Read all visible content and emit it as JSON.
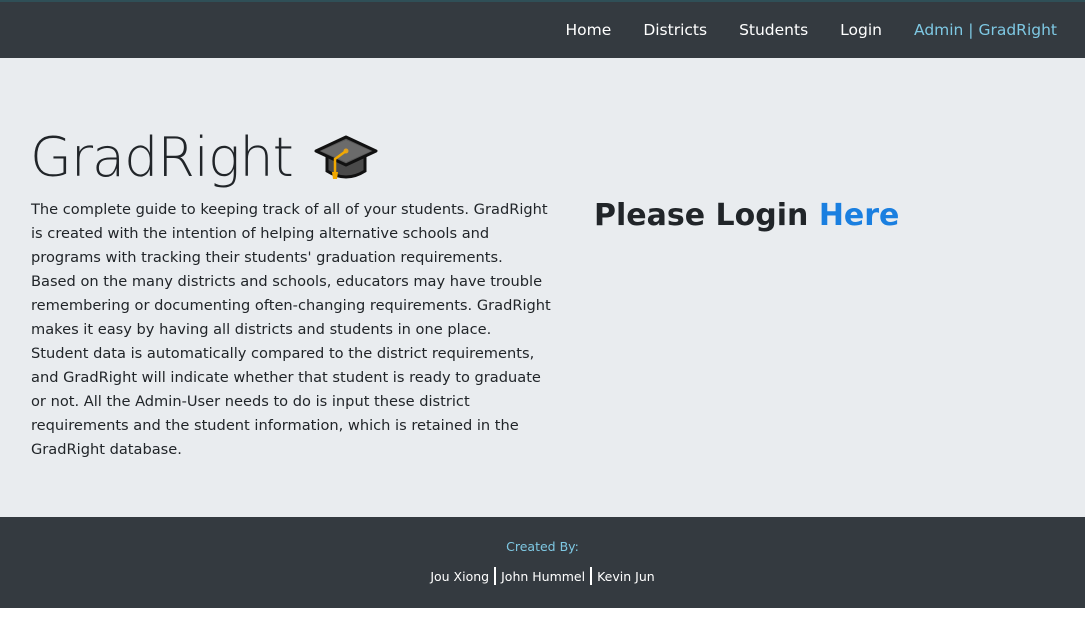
{
  "nav": {
    "items": [
      {
        "label": "Home"
      },
      {
        "label": "Districts"
      },
      {
        "label": "Students"
      },
      {
        "label": "Login"
      }
    ],
    "brand": "Admin | GradRight"
  },
  "hero": {
    "title": "GradRight",
    "icon": "graduation-cap-icon",
    "description": "The complete guide to keeping track of all of your students. GradRight is created with the intention of helping alternative schools and programs with tracking their students' graduation requirements. Based on the many districts and schools, educators may have trouble remembering or documenting often-changing requirements. GradRight makes it easy by having all districts and students in one place. Student data is automatically compared to the district requirements, and GradRight will indicate whether that student is ready to graduate or not. All the Admin-User needs to do is input these district requirements and the student information, which is retained in the GradRight database.",
    "login_prompt": "Please Login",
    "login_link": "Here"
  },
  "footer": {
    "label": "Created By:",
    "authors": [
      "Jou Xiong",
      "John Hummel",
      "Kevin Jun"
    ]
  },
  "colors": {
    "nav_bg": "#343a40",
    "page_bg": "#e9ecef",
    "accent_link": "#1a7fe0",
    "brand_text": "#7ec8e3"
  }
}
